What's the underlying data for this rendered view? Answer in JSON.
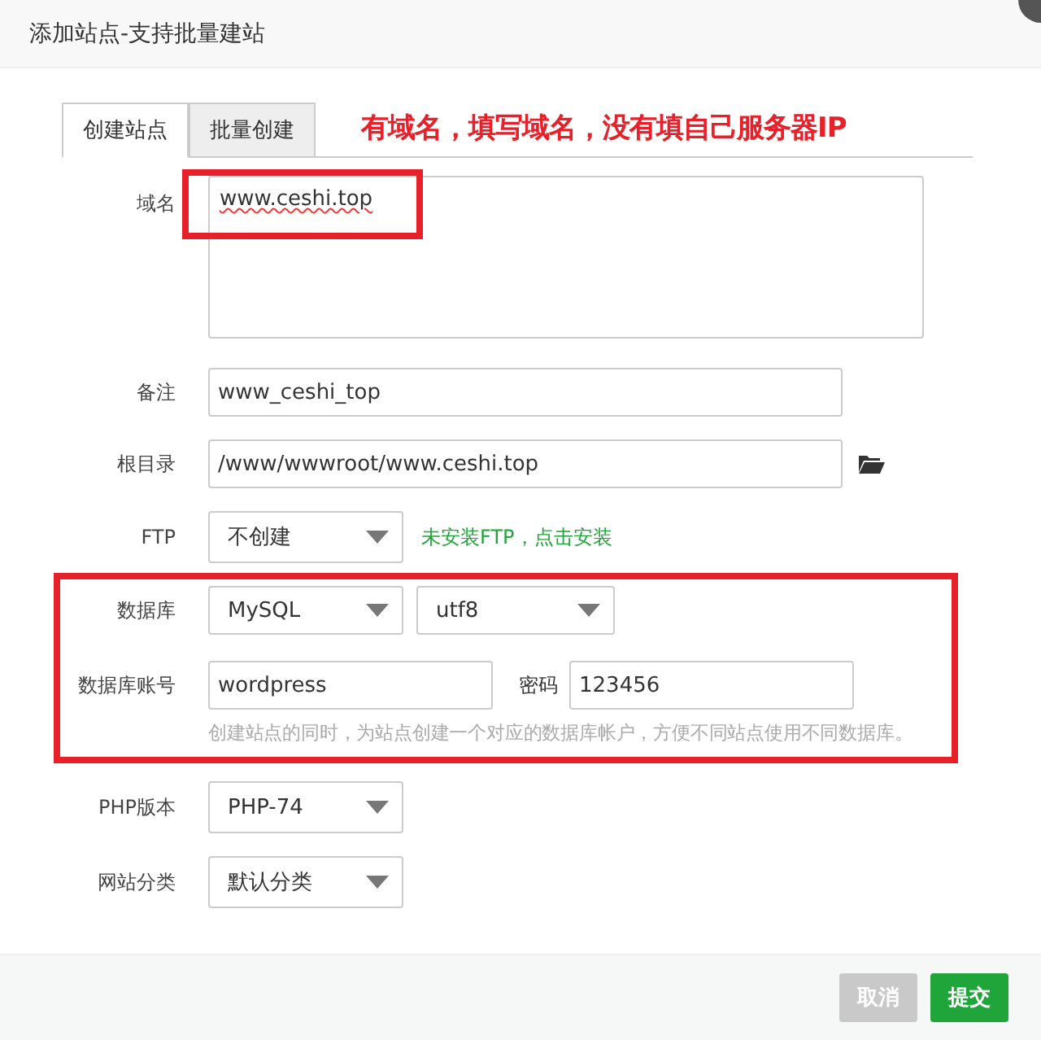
{
  "window": {
    "title": "添加站点-支持批量建站"
  },
  "tabs": [
    {
      "label": "创建站点",
      "selected": true
    },
    {
      "label": "批量创建",
      "selected": false
    }
  ],
  "annotation": "有域名，填写域名，没有填自己服务器IP",
  "fields": [
    {
      "kind": "textarea",
      "label": "域名",
      "value": "www.ceshi.top"
    },
    {
      "kind": "input",
      "label": "备注",
      "value": "www_ceshi_top"
    },
    {
      "kind": "path",
      "label": "根目录",
      "value": "/www/wwwroot/www.ceshi.top"
    },
    {
      "kind": "select",
      "label": "FTP",
      "value": "不创建",
      "note": "未安装FTP，点击安装"
    },
    {
      "kind": "select_pair",
      "label": "数据库",
      "value": "MySQL",
      "value_2": "utf8"
    },
    {
      "kind": "account",
      "label": "数据库账号",
      "value": "wordpress",
      "password_label": "密码",
      "password": "123456",
      "hint": "创建站点的同时，为站点创建一个对应的数据库帐户，方便不同站点使用不同数据库。"
    },
    {
      "kind": "select",
      "label": "PHP版本",
      "value": "PHP-74"
    },
    {
      "kind": "select",
      "label": "网站分类",
      "value": "默认分类"
    }
  ],
  "buttons": [
    {
      "label": "取消",
      "kind": "cancel"
    },
    {
      "label": "提交",
      "kind": "submit"
    }
  ]
}
